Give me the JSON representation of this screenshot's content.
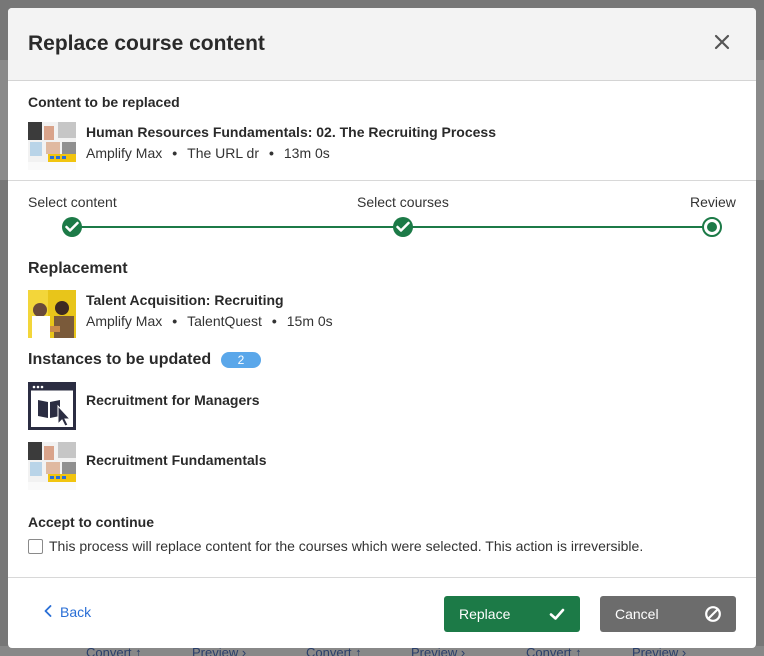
{
  "modal": {
    "title": "Replace course content",
    "content_to_be_replaced_label": "Content to be replaced",
    "original": {
      "title": "Human Resources Fundamentals: 02. The Recruiting Process",
      "provider": "Amplify Max",
      "source": "The URL dr",
      "duration": "13m 0s"
    },
    "steps": [
      {
        "label": "Select content",
        "state": "done"
      },
      {
        "label": "Select courses",
        "state": "done"
      },
      {
        "label": "Review",
        "state": "current"
      }
    ],
    "replacement_heading": "Replacement",
    "replacement": {
      "title": "Talent Acquisition: Recruiting",
      "provider": "Amplify Max",
      "source": "TalentQuest",
      "duration": "15m 0s"
    },
    "instances_heading": "Instances to be updated",
    "instances_count": "2",
    "instances": [
      {
        "title": "Recruitment for Managers",
        "icon": "course-builder-icon"
      },
      {
        "title": "Recruitment Fundamentals",
        "icon": "course-thumbnail"
      }
    ],
    "accept_heading": "Accept to continue",
    "accept_text": "This process will replace content for the courses which were selected. This action is irreversible.",
    "accept_checked": false,
    "back_label": "Back",
    "replace_label": "Replace",
    "cancel_label": "Cancel",
    "colors": {
      "primary_green": "#1c7a47",
      "badge_blue": "#5aa7ea",
      "cancel_gray": "#6c6c6c",
      "link_blue": "#2a6fd6"
    }
  },
  "background": {
    "links": [
      "Convert ↑",
      "Preview ›",
      "Convert ↑",
      "Preview ›",
      "Convert ↑",
      "Preview ›"
    ]
  }
}
